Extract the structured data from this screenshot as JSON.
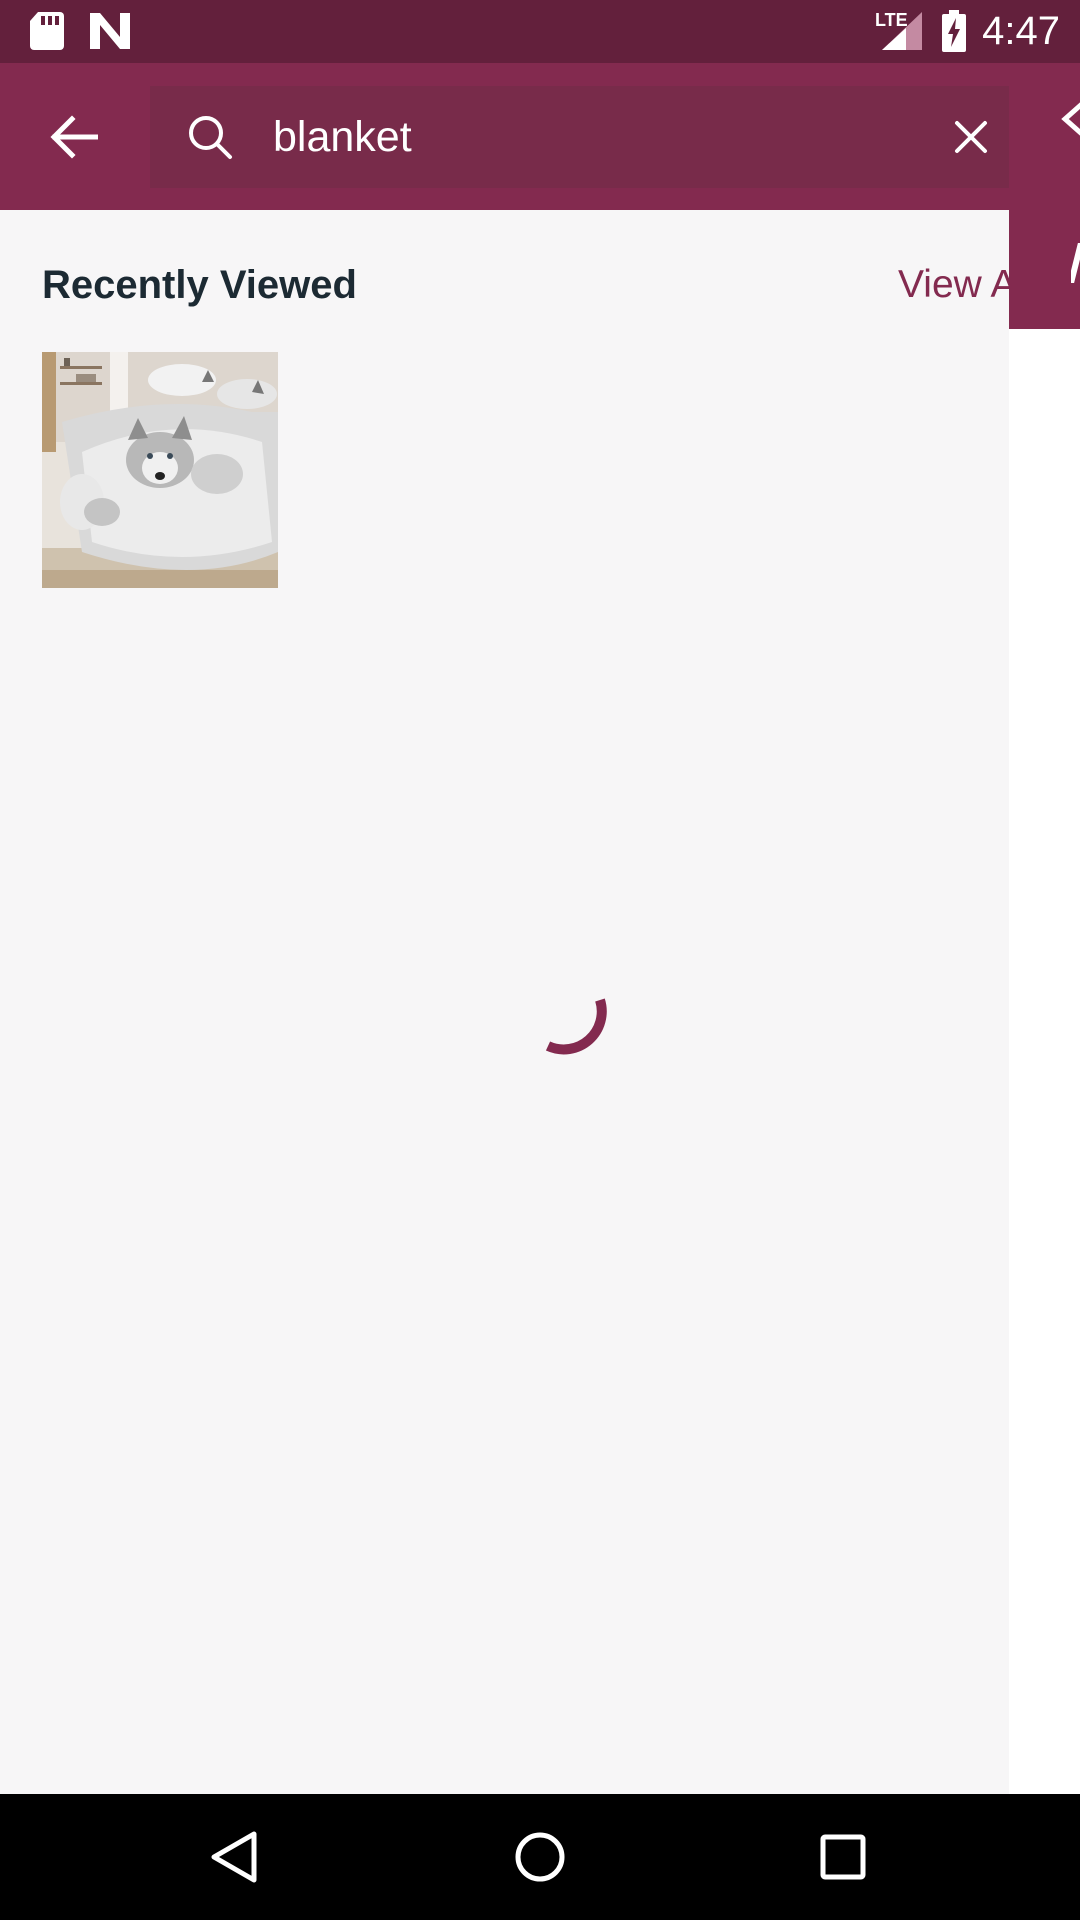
{
  "status_bar": {
    "time": "4:47",
    "network_label": "LTE",
    "icons": [
      "sd-card-icon",
      "n-logo-icon",
      "lte-signal-icon",
      "battery-charging-icon"
    ]
  },
  "search": {
    "query": "blanket",
    "back_icon": "arrow-left-icon",
    "search_icon": "search-icon",
    "clear_icon": "close-icon"
  },
  "recently_viewed": {
    "title": "Recently Viewed",
    "view_all_label": "View All",
    "items": [
      {
        "image": "wolf-print-bedding-set"
      }
    ]
  },
  "loading": {
    "spinner_color": "#832a4f"
  },
  "theme": {
    "status_bar_color": "#63203c",
    "primary_color": "#832a4f",
    "search_field_color": "#782b4a",
    "background_color": "#f7f6f7"
  },
  "navigation_bar": {
    "buttons": [
      "back-triangle-icon",
      "home-circle-icon",
      "recents-square-icon"
    ]
  }
}
